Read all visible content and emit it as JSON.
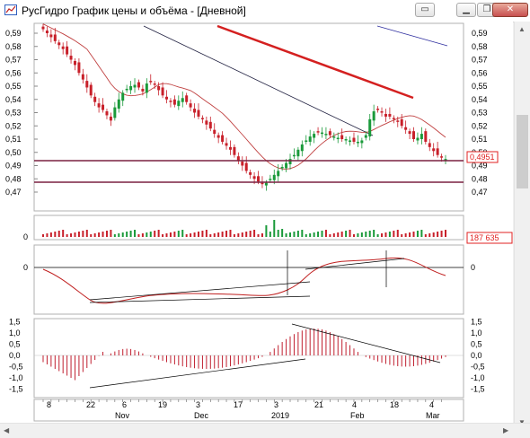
{
  "window": {
    "title": "РусГидро График цены и объёма - [Дневной]",
    "minimize_label": "▁",
    "restore_label": "❐",
    "close_label": "✕",
    "inner_controls": [
      "▭",
      "❐",
      "✕"
    ]
  },
  "price_panel": {
    "y_ticks": [
      "0,59",
      "0,58",
      "0,57",
      "0,56",
      "0,55",
      "0,54",
      "0,53",
      "0,52",
      "0,51",
      "0,50",
      "0,49",
      "0,48",
      "0,47"
    ],
    "last_price": "0,4951",
    "last_price_color": "#e02020"
  },
  "volume_panel": {
    "y_tick": "0",
    "last_volume": "187 635"
  },
  "osc_panel": {
    "y_tick": "0"
  },
  "macd_panel": {
    "y_ticks": [
      "1,5",
      "1,0",
      "0,5",
      "0,0",
      "-0,5",
      "-1,0",
      "-1,5"
    ]
  },
  "x_axis": {
    "days": [
      "8",
      "22",
      "6",
      "19",
      "3",
      "17",
      "3",
      "21",
      "4",
      "18",
      "4"
    ],
    "months": [
      "Nov",
      "Dec",
      "2019",
      "Feb",
      "Mar"
    ]
  },
  "colors": {
    "up_candle": "#1a9a3a",
    "down_candle": "#c8202a",
    "ma_line": "#c04040",
    "trend_red": "#d42020",
    "support_line": "#7a2040",
    "macd_bar": "#c02030"
  },
  "chart_data": {
    "type": "candlestick",
    "title": "РусГидро График цены и объёма - [Дневной]",
    "timeframe": "Дневной",
    "price_range": [
      0.465,
      0.595
    ],
    "horizontal_levels": [
      0.4935,
      0.4775
    ],
    "last_price": 0.4951,
    "last_volume": 187635,
    "macd_range": [
      -1.5,
      1.5
    ],
    "closes": [
      0.593,
      0.59,
      0.587,
      0.584,
      0.581,
      0.578,
      0.574,
      0.57,
      0.566,
      0.56,
      0.555,
      0.549,
      0.543,
      0.538,
      0.534,
      0.532,
      0.528,
      0.524,
      0.534,
      0.54,
      0.545,
      0.548,
      0.55,
      0.551,
      0.549,
      0.546,
      0.552,
      0.553,
      0.551,
      0.547,
      0.543,
      0.54,
      0.538,
      0.536,
      0.539,
      0.541,
      0.538,
      0.534,
      0.53,
      0.527,
      0.525,
      0.521,
      0.518,
      0.514,
      0.511,
      0.508,
      0.505,
      0.502,
      0.498,
      0.494,
      0.49,
      0.486,
      0.483,
      0.48,
      0.478,
      0.476,
      0.477,
      0.48,
      0.483,
      0.486,
      0.489,
      0.492,
      0.495,
      0.498,
      0.502,
      0.506,
      0.509,
      0.512,
      0.514,
      0.515,
      0.515,
      0.514,
      0.513,
      0.512,
      0.511,
      0.51,
      0.51,
      0.509,
      0.508,
      0.508,
      0.509,
      0.513,
      0.525,
      0.531,
      0.532,
      0.53,
      0.527,
      0.527,
      0.525,
      0.523,
      0.52,
      0.517,
      0.514,
      0.51,
      0.511,
      0.514,
      0.508,
      0.504,
      0.501,
      0.498,
      0.496,
      0.495
    ]
  }
}
